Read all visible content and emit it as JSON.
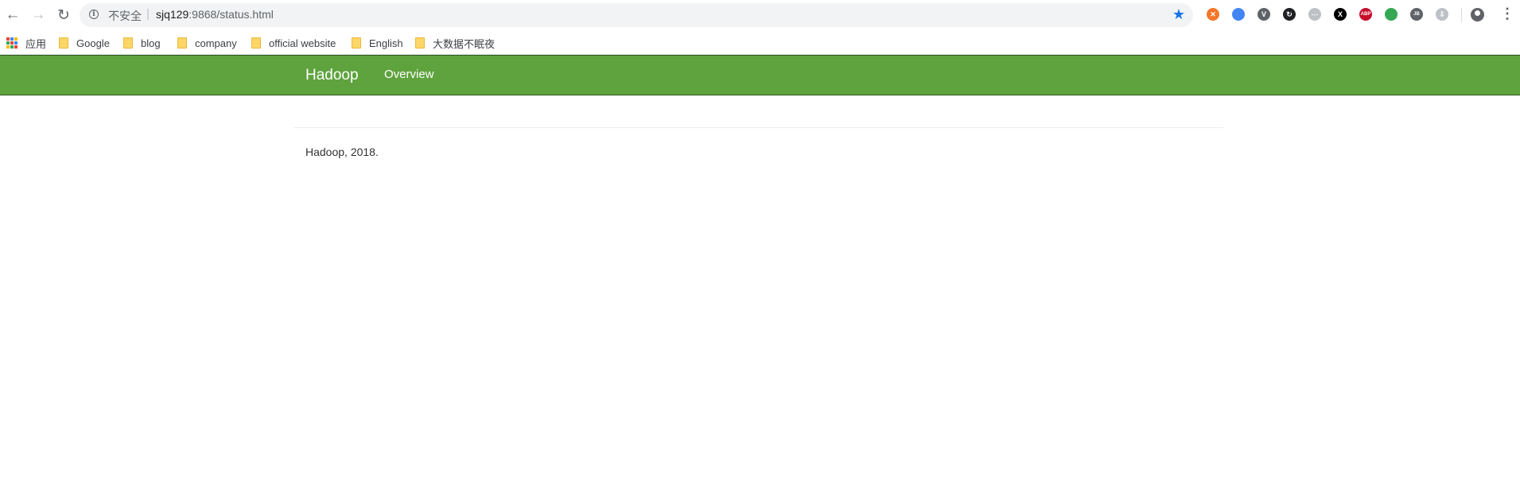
{
  "browser": {
    "security_label": "不安全",
    "url_host": "sjq129",
    "url_rest": ":9868/status.html",
    "separator": "|"
  },
  "bookmarks": [
    {
      "label": "应用",
      "icon": "apps-icon"
    },
    {
      "label": "Google",
      "icon": "folder-icon"
    },
    {
      "label": "blog",
      "icon": "folder-icon"
    },
    {
      "label": "company",
      "icon": "folder-icon"
    },
    {
      "label": "official website",
      "icon": "folder-icon"
    },
    {
      "label": "English",
      "icon": "folder-icon"
    },
    {
      "label": "大数据不眠夜",
      "icon": "folder-icon"
    }
  ],
  "extensions": [
    {
      "name": "orange-ext-icon",
      "color": "#f4772a",
      "glyph": "✕"
    },
    {
      "name": "multicolor-ext-icon",
      "color": "#4285f4",
      "glyph": ""
    },
    {
      "name": "vue-ext-icon",
      "color": "#5f6368",
      "glyph": "V"
    },
    {
      "name": "sync-ext-icon",
      "color": "#202124",
      "glyph": "↻"
    },
    {
      "name": "circle-ext-icon",
      "color": "#bdc1c6",
      "glyph": "⋯"
    },
    {
      "name": "x-ext-icon",
      "color": "#000000",
      "glyph": "X"
    },
    {
      "name": "abp-ext-icon",
      "color": "#c70d2c",
      "glyph": "ABP"
    },
    {
      "name": "chrome-ext-icon",
      "color": "#34a853",
      "glyph": ""
    },
    {
      "name": "jb-ext-icon",
      "color": "#5f6368",
      "glyph": "JB"
    },
    {
      "name": "download-ext-icon",
      "color": "#bdc1c6",
      "glyph": "⇩"
    }
  ],
  "colors": {
    "navbar_bg": "#5fa33e",
    "link_blue": "#1a73e8"
  },
  "navbar": {
    "brand": "Hadoop",
    "links": [
      "Overview"
    ]
  },
  "footer": {
    "text": "Hadoop, 2018."
  }
}
